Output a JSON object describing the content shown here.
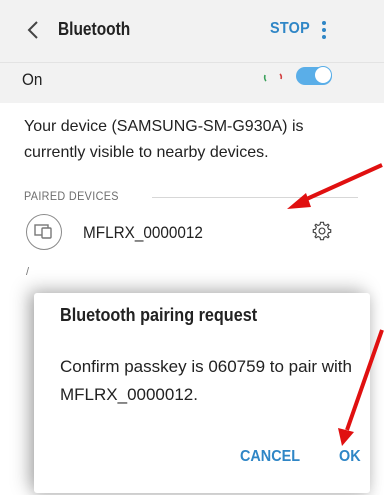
{
  "header": {
    "title": "Bluetooth",
    "stop_label": "STOP",
    "back_icon": "chevron-left-icon",
    "more_icon": "more-vertical-icon"
  },
  "bluetooth_toggle": {
    "label": "On",
    "state": "on",
    "scanning": true
  },
  "visibility_message": "Your device (SAMSUNG-SM-G930A) is currently visible to nearby devices.",
  "paired_section": {
    "label": "PAIRED DEVICES",
    "devices": [
      {
        "name": "MFLRX_0000012",
        "icon": "devices-icon",
        "settings_icon": "gear-icon"
      }
    ]
  },
  "dialog": {
    "title": "Bluetooth pairing request",
    "message": "Confirm passkey is 060759 to pair with MFLRX_0000012.",
    "cancel_label": "CANCEL",
    "ok_label": "OK"
  },
  "colors": {
    "accent": "#2f86c6",
    "toggle_on": "#5aaee8",
    "header_bg": "#f2f2f2",
    "annotation_red": "#e01010"
  }
}
